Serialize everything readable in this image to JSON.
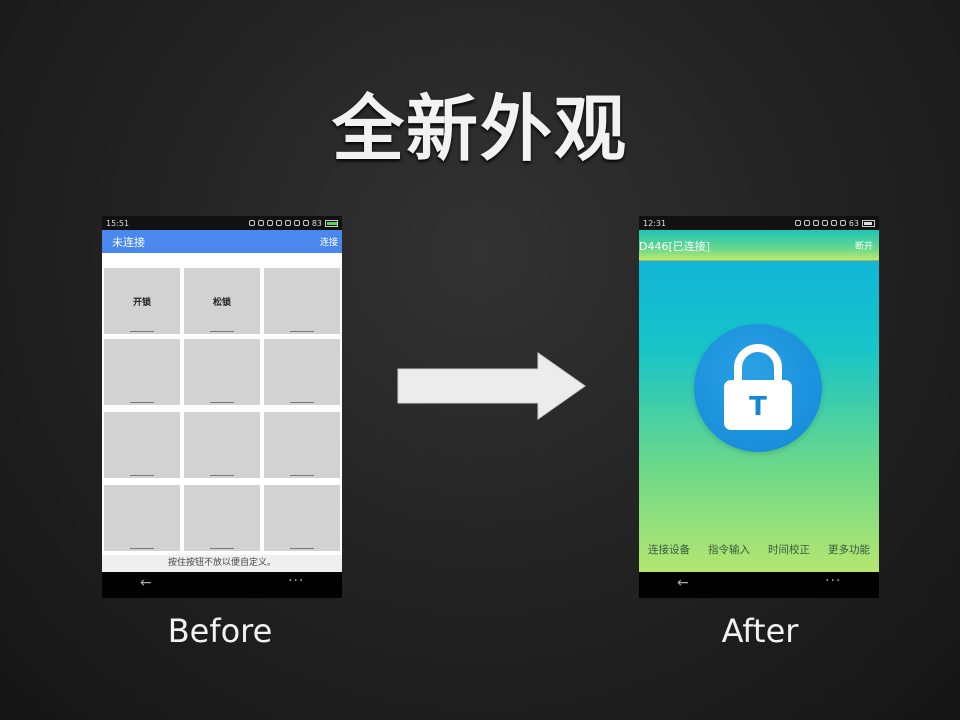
{
  "slide": {
    "title": "全新外观",
    "before_caption": "Before",
    "after_caption": "After"
  },
  "before_phone": {
    "status_time": "15:51",
    "battery_level": "83",
    "app_title": "未连接",
    "connect_button": "连接",
    "grid_buttons": [
      "开锁",
      "松锁",
      "",
      "",
      "",
      "",
      "",
      "",
      "",
      "",
      "",
      ""
    ],
    "hint_text": "按住按钮不放以便自定义。",
    "nav_back_glyph": "←",
    "nav_menu_glyph": "···"
  },
  "after_phone": {
    "status_time": "12:31",
    "battery_level": "63",
    "device_status": "D446[已连接]",
    "disconnect_button": "断开",
    "lock_letter": "T",
    "menu": [
      "连接设备",
      "指令输入",
      "时间校正",
      "更多功能"
    ],
    "nav_back_glyph": "←",
    "nav_menu_glyph": "···"
  },
  "colors": {
    "before_appbar": "#4a88ee",
    "after_lock_circle": "#1387d8",
    "arrow": "#ececec"
  },
  "icons": {
    "arrow": "right-arrow-icon",
    "lock": "padlock-icon"
  }
}
